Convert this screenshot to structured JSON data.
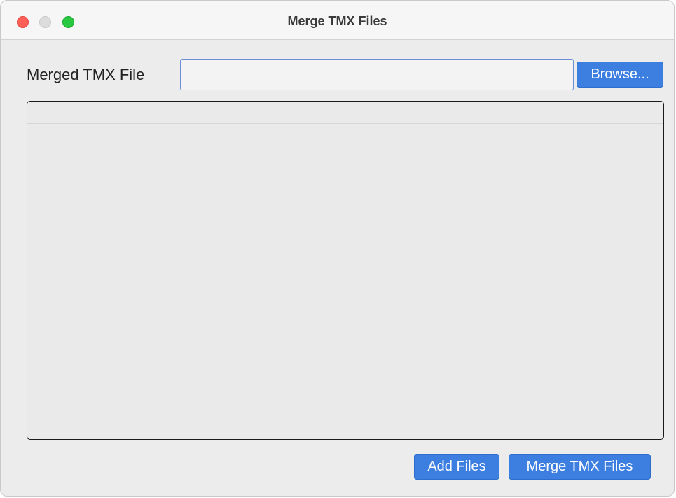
{
  "window": {
    "title": "Merge TMX Files"
  },
  "form": {
    "merged_file_label": "Merged TMX File",
    "merged_file_value": "",
    "browse_label": "Browse..."
  },
  "file_list": {
    "rows": []
  },
  "actions": {
    "add_files_label": "Add Files",
    "merge_label": "Merge TMX Files"
  },
  "colors": {
    "accent": "#3c7fe0",
    "window_bg": "#ececec",
    "close": "#ff5f57",
    "zoom": "#28c840"
  }
}
